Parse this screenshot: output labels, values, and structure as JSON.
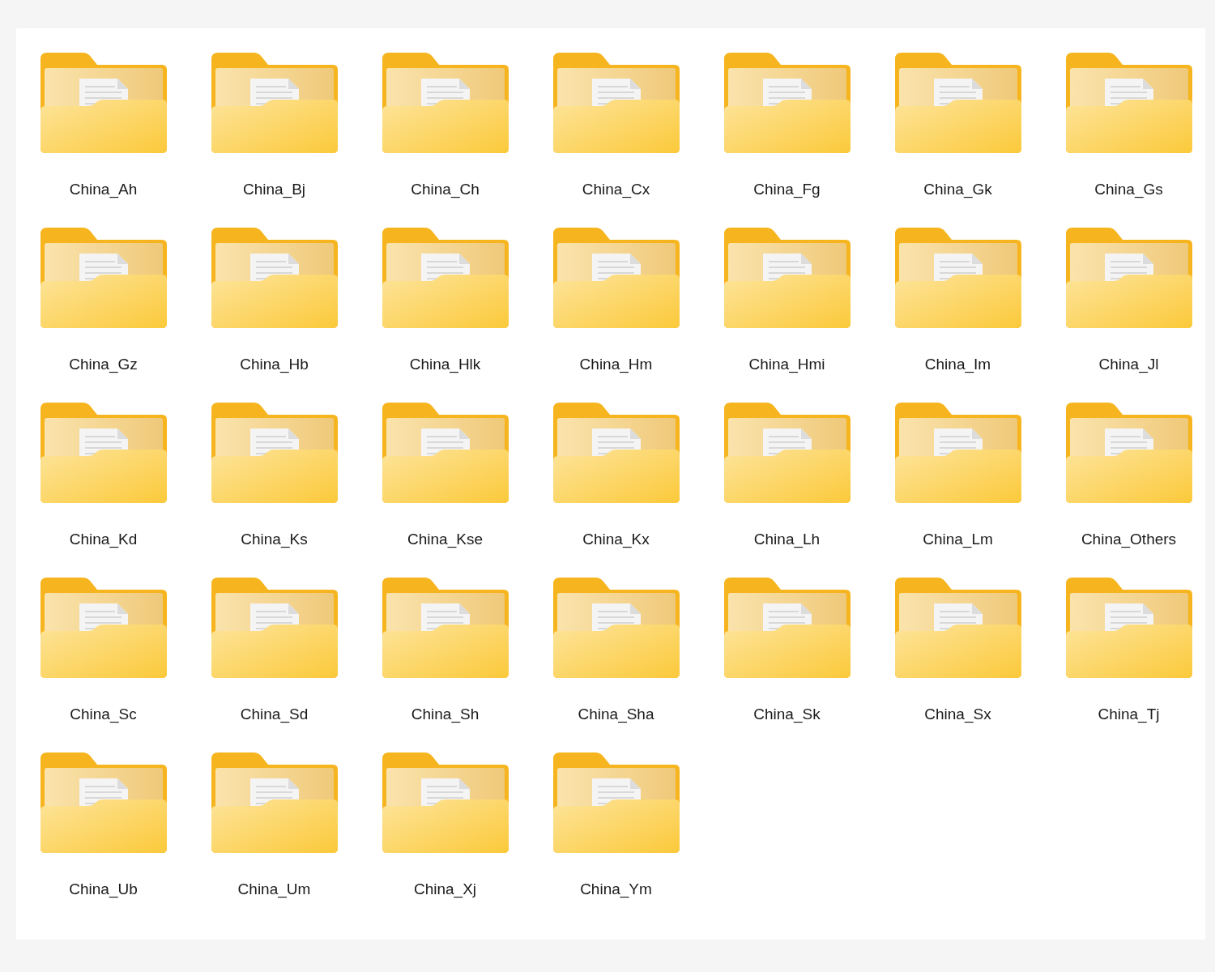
{
  "folders": [
    {
      "name": "China_Ah"
    },
    {
      "name": "China_Bj"
    },
    {
      "name": "China_Ch"
    },
    {
      "name": "China_Cx"
    },
    {
      "name": "China_Fg"
    },
    {
      "name": "China_Gk"
    },
    {
      "name": "China_Gs"
    },
    {
      "name": "China_Gz"
    },
    {
      "name": "China_Hb"
    },
    {
      "name": "China_Hlk"
    },
    {
      "name": "China_Hm"
    },
    {
      "name": "China_Hmi"
    },
    {
      "name": "China_Im"
    },
    {
      "name": "China_Jl"
    },
    {
      "name": "China_Kd"
    },
    {
      "name": "China_Ks"
    },
    {
      "name": "China_Kse"
    },
    {
      "name": "China_Kx"
    },
    {
      "name": "China_Lh"
    },
    {
      "name": "China_Lm"
    },
    {
      "name": "China_Others"
    },
    {
      "name": "China_Sc"
    },
    {
      "name": "China_Sd"
    },
    {
      "name": "China_Sh"
    },
    {
      "name": "China_Sha"
    },
    {
      "name": "China_Sk"
    },
    {
      "name": "China_Sx"
    },
    {
      "name": "China_Tj"
    },
    {
      "name": "China_Ub"
    },
    {
      "name": "China_Um"
    },
    {
      "name": "China_Xj"
    },
    {
      "name": "China_Ym"
    }
  ]
}
